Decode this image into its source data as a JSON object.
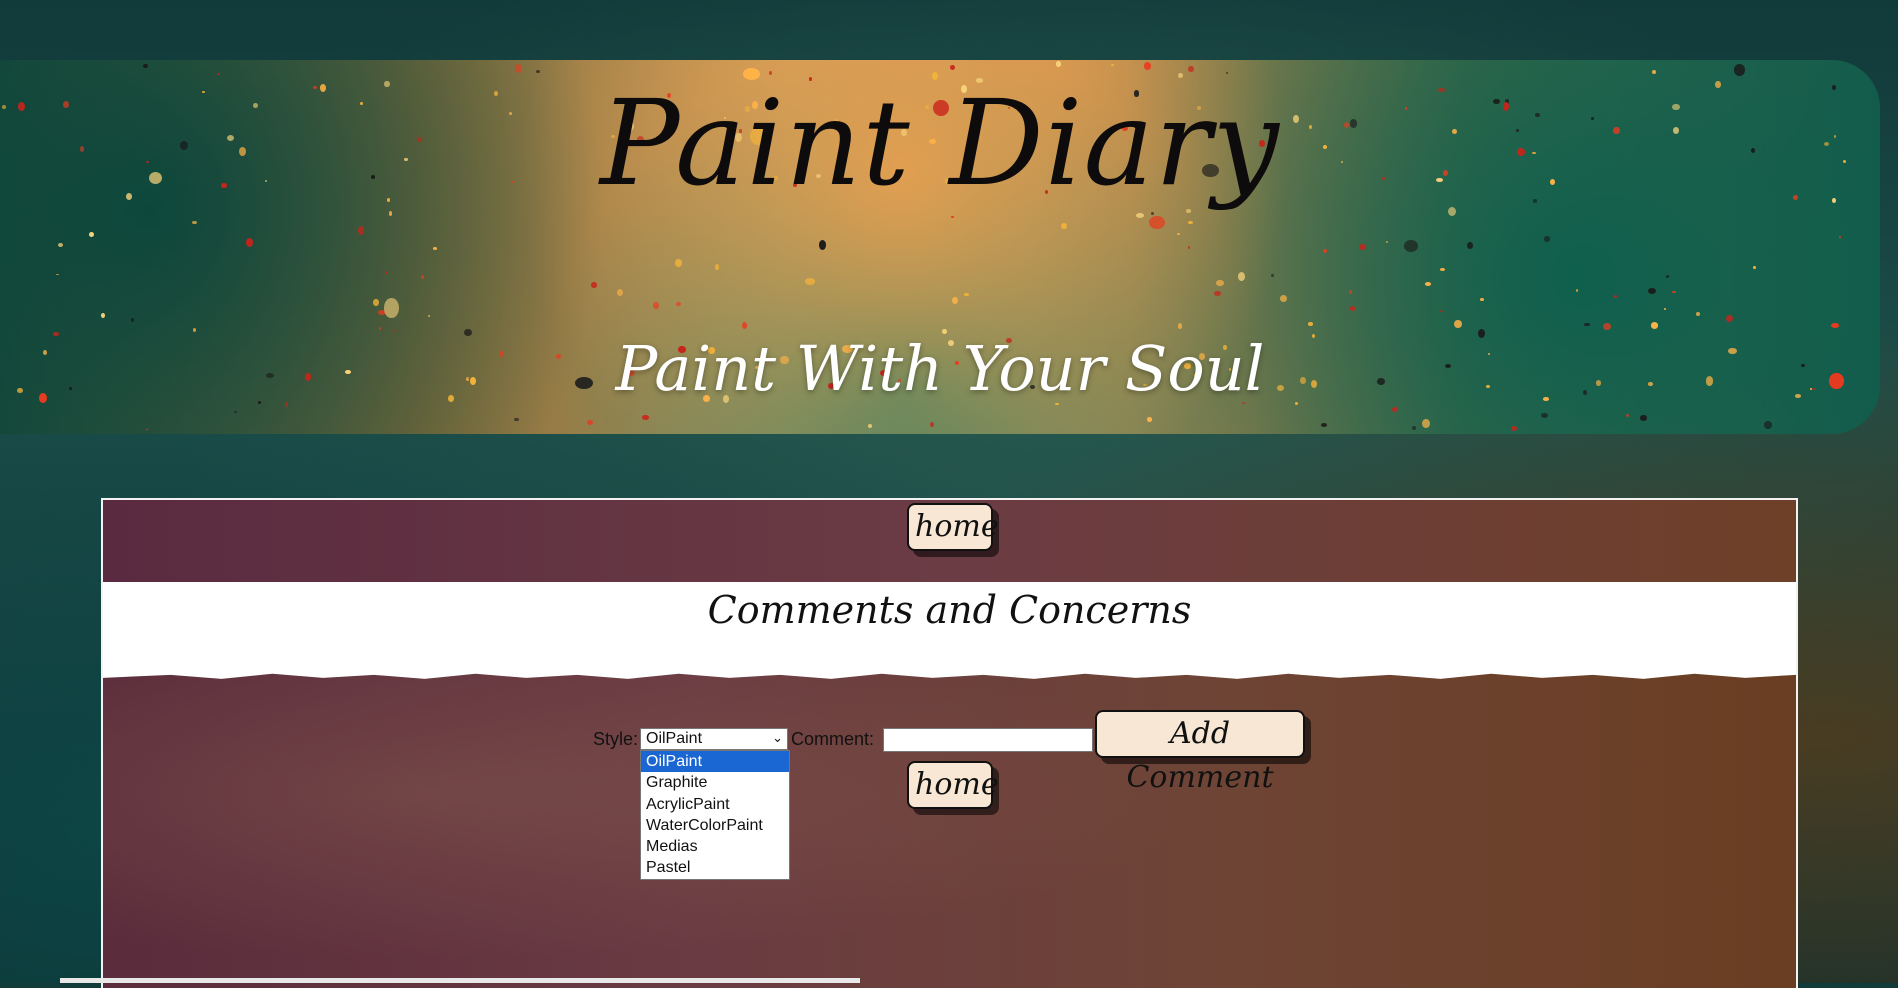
{
  "banner": {
    "title": "Paint Diary",
    "tagline": "Paint With Your Soul"
  },
  "nav": {
    "home_label": "home"
  },
  "section": {
    "heading": "Comments and Concerns"
  },
  "form": {
    "style_label": "Style:",
    "style_selected": "OilPaint",
    "style_options": [
      "OilPaint",
      "Graphite",
      "AcrylicPaint",
      "WaterColorPaint",
      "Medias",
      "Pastel"
    ],
    "comment_label": "Comment:",
    "comment_value": "",
    "add_button_label": "Add Comment",
    "home_label": "home"
  },
  "colors": {
    "button_bg": "#f7e7d4",
    "dropdown_highlight": "#1a66d2"
  }
}
